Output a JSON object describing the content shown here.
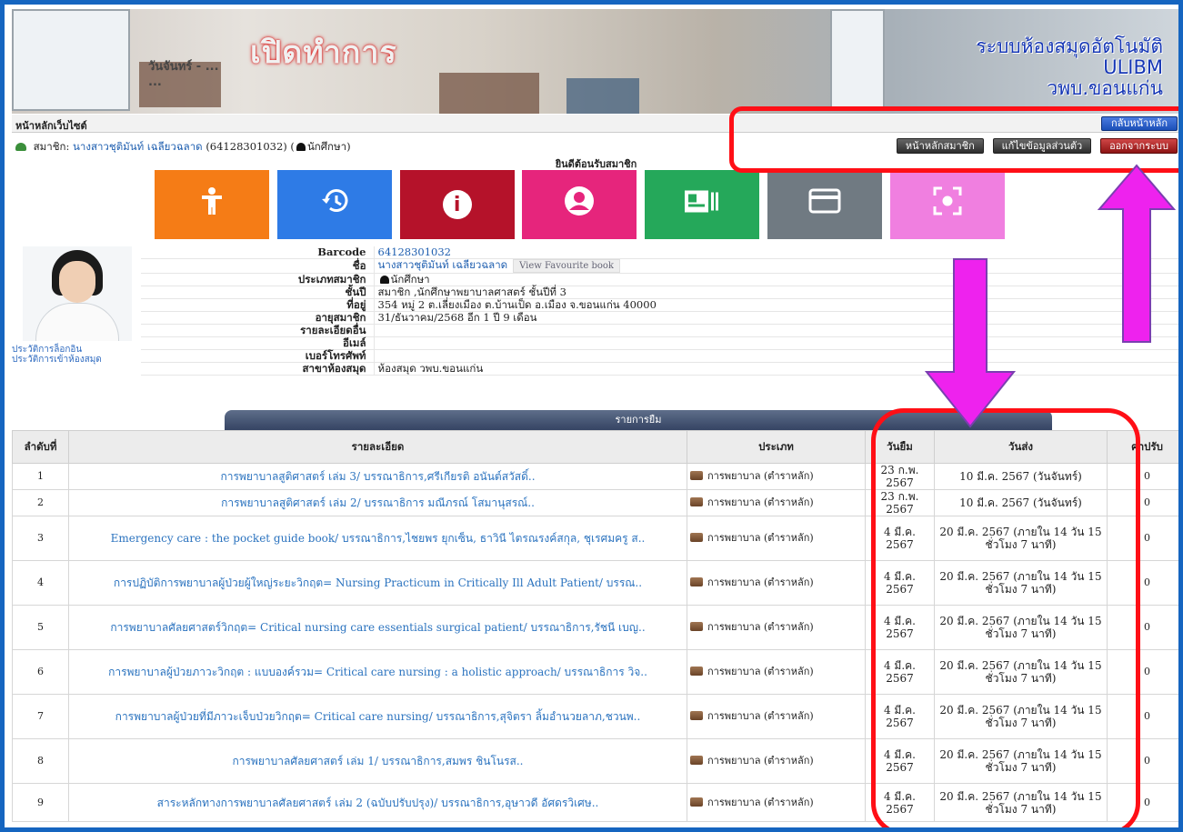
{
  "banner": {
    "sign_main": "เปิดทำการ",
    "sign_lines": [
      "วันจันทร์ - ...",
      "..."
    ],
    "title_lines": [
      "ระบบห้องสมุดอัตโนมัติ",
      "ULIBM",
      "วพบ.ขอนแก่น"
    ]
  },
  "nav": {
    "site_home": "หน้าหลักเว็บไซต์",
    "back_home": "กลับหน้าหลัก",
    "member_label": "สมาชิก:",
    "member_name": "นางสาวชุติมันท์ เฉลียวฉลาด",
    "member_code": "(64128301032)",
    "member_type": "นักศึกษา",
    "buttons": [
      "หน้าหลักสมาชิก",
      "แก้ไขข้อมูลส่วนตัว",
      "ออกจากระบบ"
    ],
    "welcome": "ยินดีต้อนรับสมาชิก"
  },
  "tiles": [
    {
      "icon": "person-icon",
      "color": "#f57c16"
    },
    {
      "icon": "history-icon",
      "color": "#2e7be6"
    },
    {
      "icon": "info-icon",
      "color": "#b5122a"
    },
    {
      "icon": "user-circle-icon",
      "color": "#e6257c"
    },
    {
      "icon": "id-card-icon",
      "color": "#25a85a"
    },
    {
      "icon": "credit-card-icon",
      "color": "#707a82"
    },
    {
      "icon": "scan-icon",
      "color": "#f07fe0"
    }
  ],
  "member": {
    "fields": [
      {
        "k": "Barcode",
        "v": "64128301032"
      },
      {
        "k": "ชื่อ",
        "v": "นางสาวชุติมันท์ เฉลียวฉลาด",
        "extra": "View Favourite book"
      },
      {
        "k": "ประเภทสมาชิก",
        "v": "นักศึกษา"
      },
      {
        "k": "ชั้นปี",
        "v": "สมาชิก ,นักศึกษาพยาบาลศาสตร์ ชั้นปีที่ 3"
      },
      {
        "k": "ที่อยู่",
        "v": "354 หมู่ 2 ต.เลี่ยงเมือง ต.บ้านเป็ด อ.เมือง จ.ขอนแก่น 40000"
      },
      {
        "k": "อายุสมาชิก",
        "v": "31/ธันวาคม/2568 อีก 1 ปี 9 เดือน"
      },
      {
        "k": "รายละเอียดอื่น",
        "v": ""
      },
      {
        "k": "อีเมล์",
        "v": ""
      },
      {
        "k": "เบอร์โทรศัพท์",
        "v": ""
      },
      {
        "k": "สาขาห้องสมุด",
        "v": "ห้องสมุด วพบ.ขอนแก่น"
      }
    ],
    "side_links": [
      "ประวัติการล็อกอิน",
      "ประวัติการเข้าห้องสมุด"
    ]
  },
  "loans": {
    "tab": "รายการยืม",
    "headers": [
      "ลำดับที่",
      "รายละเอียด",
      "ประเภท",
      "วันยืม",
      "วันส่ง",
      "ค่าปรับ"
    ],
    "rows": [
      {
        "n": "1",
        "desc": "การพยาบาลสูติศาสตร์ เล่ม 3/ บรรณาธิการ,ศรีเกียรติ อนันต์สวัสดิ์..",
        "cat": "การพยาบาล (ตำราหลัก)",
        "borrow": "23 ก.พ. 2567",
        "due": "10 มี.ค. 2567 (วันจันทร์)",
        "fee": "0"
      },
      {
        "n": "2",
        "desc": "การพยาบาลสูติศาสตร์ เล่ม 2/ บรรณาธิการ มณีภรณ์ โสมานุสรณ์..",
        "cat": "การพยาบาล (ตำราหลัก)",
        "borrow": "23 ก.พ. 2567",
        "due": "10 มี.ค. 2567 (วันจันทร์)",
        "fee": "0"
      },
      {
        "n": "3",
        "desc": "Emergency care : the pocket guide book/ บรรณาธิการ,ไชยพร ยุกเซ็น, ธาวินี ไตรณรงค์สกุล, ชุเรศมครู ส..",
        "cat": "การพยาบาล (ตำราหลัก)",
        "borrow": "4 มี.ค. 2567",
        "due": "20 มี.ค. 2567 (ภายใน 14 วัน 15 ชั่วโมง 7 นาที)",
        "fee": "0"
      },
      {
        "n": "4",
        "desc": "การปฏิบัติการพยาบาลผู้ป่วยผู้ใหญ่ระยะวิกฤต= Nursing Practicum in Critically Ill Adult Patient/ บรรณ..",
        "cat": "การพยาบาล (ตำราหลัก)",
        "borrow": "4 มี.ค. 2567",
        "due": "20 มี.ค. 2567 (ภายใน 14 วัน 15 ชั่วโมง 7 นาที)",
        "fee": "0"
      },
      {
        "n": "5",
        "desc": "การพยาบาลศัลยศาสตร์วิกฤต= Critical nursing care essentials surgical patient/ บรรณาธิการ,รัชนี เบญ..",
        "cat": "การพยาบาล (ตำราหลัก)",
        "borrow": "4 มี.ค. 2567",
        "due": "20 มี.ค. 2567 (ภายใน 14 วัน 15 ชั่วโมง 7 นาที)",
        "fee": "0"
      },
      {
        "n": "6",
        "desc": "การพยาบาลผู้ป่วยภาวะวิกฤต : แบบองค์รวม= Critical care nursing : a holistic approach/ บรรณาธิการ วิจ..",
        "cat": "การพยาบาล (ตำราหลัก)",
        "borrow": "4 มี.ค. 2567",
        "due": "20 มี.ค. 2567 (ภายใน 14 วัน 15 ชั่วโมง 7 นาที)",
        "fee": "0"
      },
      {
        "n": "7",
        "desc": "การพยาบาลผู้ป่วยที่มีภาวะเจ็บป่วยวิกฤต= Critical care nursing/ บรรณาธิการ,สุจิตรา ลิ้มอำนวยลาภ,ชวนพ..",
        "cat": "การพยาบาล (ตำราหลัก)",
        "borrow": "4 มี.ค. 2567",
        "due": "20 มี.ค. 2567 (ภายใน 14 วัน 15 ชั่วโมง 7 นาที)",
        "fee": "0"
      },
      {
        "n": "8",
        "desc": "การพยาบาลศัลยศาสตร์ เล่ม 1/ บรรณาธิการ,สมพร ชินโนรส..",
        "cat": "การพยาบาล (ตำราหลัก)",
        "borrow": "4 มี.ค. 2567",
        "due": "20 มี.ค. 2567 (ภายใน 14 วัน 15 ชั่วโมง 7 นาที)",
        "fee": "0"
      },
      {
        "n": "9",
        "desc": "สาระหลักทางการพยาบาลศัลยศาสตร์ เล่ม 2 (ฉบับปรับปรุง)/ บรรณาธิการ,อุษาวดี อัศดรวิเศษ..",
        "cat": "การพยาบาล (ตำราหลัก)",
        "borrow": "4 มี.ค. 2567",
        "due": "20 มี.ค. 2567 (ภายใน 14 วัน 15 ชั่วโมง 7 นาที)",
        "fee": "0"
      }
    ]
  },
  "annotation_colors": {
    "highlight": "#ff0f16",
    "arrow": "#ee22ee"
  }
}
